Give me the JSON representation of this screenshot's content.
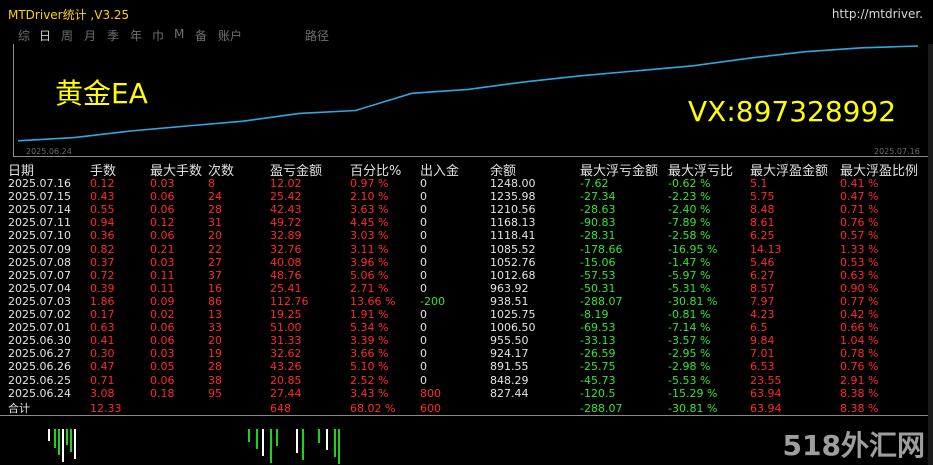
{
  "window": {
    "title": "MTDriver统计 ,V3.25",
    "url": "http://mtdriver."
  },
  "tabs": [
    "综",
    "日",
    "周",
    "月",
    "季",
    "年",
    "巾",
    "M",
    "备",
    "账户",
    "",
    "路径"
  ],
  "chart": {
    "ea_label": "黄金EA",
    "vx_label": "VX:897328992",
    "start_date": "2025.06.24",
    "end_date": "2025.07.16",
    "line_color": "#2fa8df"
  },
  "chart_data": {
    "type": "line",
    "x": [
      "2025.06.24",
      "2025.06.25",
      "2025.06.26",
      "2025.06.27",
      "2025.06.30",
      "2025.07.01",
      "2025.07.02",
      "2025.07.03",
      "2025.07.04",
      "2025.07.07",
      "2025.07.08",
      "2025.07.09",
      "2025.07.10",
      "2025.07.11",
      "2025.07.14",
      "2025.07.15",
      "2025.07.16"
    ],
    "y": [
      27.44,
      48.29,
      91.55,
      124.17,
      155.5,
      206.5,
      225.75,
      338.51,
      363.92,
      412.68,
      452.76,
      485.52,
      518.41,
      568.13,
      610.56,
      635.98,
      648.0
    ]
  },
  "table": {
    "headers": [
      "日期",
      "手数",
      "最大手数",
      "次数",
      "盈亏金额",
      "百分比%",
      "出入金",
      "余额",
      "最大浮亏金额",
      "最大浮亏比",
      "最大浮盈金额",
      "最大浮盈比例"
    ],
    "rows": [
      [
        "2025.07.16",
        "0.12",
        "0.03",
        "8",
        "12.02",
        "0.97 %",
        "0",
        "1248.00",
        "-7.62",
        "-0.62 %",
        "5.1",
        "0.41 %"
      ],
      [
        "2025.07.15",
        "0.43",
        "0.06",
        "24",
        "25.42",
        "2.10 %",
        "0",
        "1235.98",
        "-27.34",
        "-2.23 %",
        "5.75",
        "0.47 %"
      ],
      [
        "2025.07.14",
        "0.55",
        "0.06",
        "28",
        "42.43",
        "3.63 %",
        "0",
        "1210.56",
        "-28.63",
        "-2.40 %",
        "8.48",
        "0.71 %"
      ],
      [
        "2025.07.11",
        "0.94",
        "0.12",
        "31",
        "49.72",
        "4.45 %",
        "0",
        "1168.13",
        "-90.83",
        "-7.89 %",
        "8.61",
        "0.76 %"
      ],
      [
        "2025.07.10",
        "0.36",
        "0.06",
        "20",
        "32.89",
        "3.03 %",
        "0",
        "1118.41",
        "-28.31",
        "-2.58 %",
        "6.25",
        "0.57 %"
      ],
      [
        "2025.07.09",
        "0.82",
        "0.21",
        "22",
        "32.76",
        "3.11 %",
        "0",
        "1085.52",
        "-178.66",
        "-16.95 %",
        "14.13",
        "1.33 %"
      ],
      [
        "2025.07.08",
        "0.37",
        "0.03",
        "27",
        "40.08",
        "3.96 %",
        "0",
        "1052.76",
        "-15.06",
        "-1.47 %",
        "5.46",
        "0.53 %"
      ],
      [
        "2025.07.07",
        "0.72",
        "0.11",
        "37",
        "48.76",
        "5.06 %",
        "0",
        "1012.68",
        "-57.53",
        "-5.97 %",
        "6.27",
        "0.63 %"
      ],
      [
        "2025.07.04",
        "0.39",
        "0.11",
        "16",
        "25.41",
        "2.71 %",
        "0",
        "963.92",
        "-50.31",
        "-5.31 %",
        "8.57",
        "0.90 %"
      ],
      [
        "2025.07.03",
        "1.86",
        "0.09",
        "86",
        "112.76",
        "13.66 %",
        "-200",
        "938.51",
        "-288.07",
        "-30.81 %",
        "7.97",
        "0.77 %"
      ],
      [
        "2025.07.02",
        "0.17",
        "0.02",
        "13",
        "19.25",
        "1.91 %",
        "0",
        "1025.75",
        "-8.19",
        "-0.81 %",
        "4.23",
        "0.42 %"
      ],
      [
        "2025.07.01",
        "0.63",
        "0.06",
        "33",
        "51.00",
        "5.34 %",
        "0",
        "1006.50",
        "-69.53",
        "-7.14 %",
        "6.5",
        "0.66 %"
      ],
      [
        "2025.06.30",
        "0.41",
        "0.06",
        "20",
        "31.33",
        "3.39 %",
        "0",
        "955.50",
        "-33.13",
        "-3.57 %",
        "9.84",
        "1.04 %"
      ],
      [
        "2025.06.27",
        "0.30",
        "0.03",
        "19",
        "32.62",
        "3.66 %",
        "0",
        "924.17",
        "-26.59",
        "-2.95 %",
        "7.01",
        "0.78 %"
      ],
      [
        "2025.06.26",
        "0.47",
        "0.05",
        "28",
        "43.26",
        "5.10 %",
        "0",
        "891.55",
        "-25.75",
        "-2.98 %",
        "6.53",
        "0.76 %"
      ],
      [
        "2025.06.25",
        "0.71",
        "0.06",
        "38",
        "20.85",
        "2.52 %",
        "0",
        "848.29",
        "-45.73",
        "-5.53 %",
        "23.55",
        "2.91 %"
      ],
      [
        "2025.06.24",
        "3.08",
        "0.18",
        "95",
        "27.44",
        "3.43 %",
        "800",
        "827.44",
        "-120.5",
        "-15.29 %",
        "63.94",
        "8.38 %"
      ]
    ],
    "total": [
      "合计",
      "12.33",
      "",
      "",
      "648",
      "68.02 %",
      "600",
      "",
      "-288.07",
      "-30.81 %",
      "63.94",
      "8.38 %"
    ]
  },
  "watermark": "518外汇网"
}
